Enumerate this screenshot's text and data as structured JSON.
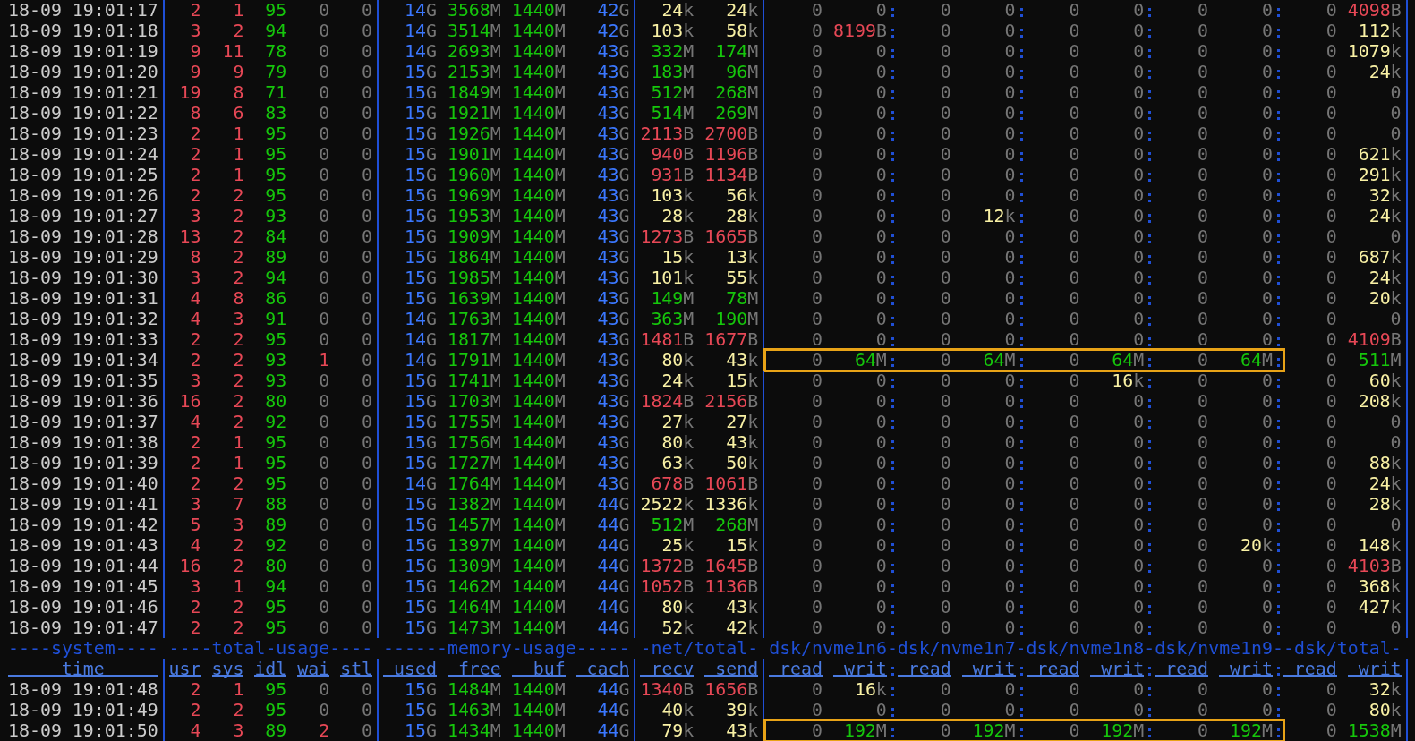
{
  "rows": [
    {
      "time": "18-09 19:01:17",
      "values": [
        "2",
        "1",
        "95",
        "0",
        "0",
        "14G",
        "3568M",
        "1440M",
        "42G",
        "24k",
        "24k",
        "0",
        "0",
        "0",
        "0",
        "0",
        "0",
        "0",
        "0",
        "0",
        "4098B"
      ],
      "highlighted": false
    },
    {
      "time": "18-09 19:01:18",
      "values": [
        "3",
        "2",
        "94",
        "0",
        "0",
        "14G",
        "3514M",
        "1440M",
        "42G",
        "103k",
        "58k",
        "0",
        "8199B",
        "0",
        "0",
        "0",
        "0",
        "0",
        "0",
        "0",
        "112k"
      ],
      "highlighted": false
    },
    {
      "time": "18-09 19:01:19",
      "values": [
        "9",
        "11",
        "78",
        "0",
        "0",
        "14G",
        "2693M",
        "1440M",
        "43G",
        "332M",
        "174M",
        "0",
        "0",
        "0",
        "0",
        "0",
        "0",
        "0",
        "0",
        "0",
        "1079k"
      ],
      "highlighted": false
    },
    {
      "time": "18-09 19:01:20",
      "values": [
        "9",
        "9",
        "79",
        "0",
        "0",
        "15G",
        "2153M",
        "1440M",
        "43G",
        "183M",
        "96M",
        "0",
        "0",
        "0",
        "0",
        "0",
        "0",
        "0",
        "0",
        "0",
        "24k"
      ],
      "highlighted": false
    },
    {
      "time": "18-09 19:01:21",
      "values": [
        "19",
        "8",
        "71",
        "0",
        "0",
        "15G",
        "1849M",
        "1440M",
        "43G",
        "512M",
        "268M",
        "0",
        "0",
        "0",
        "0",
        "0",
        "0",
        "0",
        "0",
        "0",
        "0"
      ],
      "highlighted": false
    },
    {
      "time": "18-09 19:01:22",
      "values": [
        "8",
        "6",
        "83",
        "0",
        "0",
        "15G",
        "1921M",
        "1440M",
        "43G",
        "514M",
        "269M",
        "0",
        "0",
        "0",
        "0",
        "0",
        "0",
        "0",
        "0",
        "0",
        "0"
      ],
      "highlighted": false
    },
    {
      "time": "18-09 19:01:23",
      "values": [
        "2",
        "1",
        "95",
        "0",
        "0",
        "15G",
        "1926M",
        "1440M",
        "43G",
        "2113B",
        "2700B",
        "0",
        "0",
        "0",
        "0",
        "0",
        "0",
        "0",
        "0",
        "0",
        "0"
      ],
      "highlighted": false
    },
    {
      "time": "18-09 19:01:24",
      "values": [
        "2",
        "1",
        "95",
        "0",
        "0",
        "15G",
        "1901M",
        "1440M",
        "43G",
        "940B",
        "1196B",
        "0",
        "0",
        "0",
        "0",
        "0",
        "0",
        "0",
        "0",
        "0",
        "621k"
      ],
      "highlighted": false
    },
    {
      "time": "18-09 19:01:25",
      "values": [
        "2",
        "1",
        "95",
        "0",
        "0",
        "15G",
        "1960M",
        "1440M",
        "43G",
        "931B",
        "1134B",
        "0",
        "0",
        "0",
        "0",
        "0",
        "0",
        "0",
        "0",
        "0",
        "291k"
      ],
      "highlighted": false
    },
    {
      "time": "18-09 19:01:26",
      "values": [
        "2",
        "2",
        "95",
        "0",
        "0",
        "15G",
        "1969M",
        "1440M",
        "43G",
        "103k",
        "56k",
        "0",
        "0",
        "0",
        "0",
        "0",
        "0",
        "0",
        "0",
        "0",
        "32k"
      ],
      "highlighted": false
    },
    {
      "time": "18-09 19:01:27",
      "values": [
        "3",
        "2",
        "93",
        "0",
        "0",
        "15G",
        "1953M",
        "1440M",
        "43G",
        "28k",
        "28k",
        "0",
        "0",
        "0",
        "12k",
        "0",
        "0",
        "0",
        "0",
        "0",
        "24k"
      ],
      "highlighted": false
    },
    {
      "time": "18-09 19:01:28",
      "values": [
        "13",
        "2",
        "84",
        "0",
        "0",
        "15G",
        "1909M",
        "1440M",
        "43G",
        "1273B",
        "1665B",
        "0",
        "0",
        "0",
        "0",
        "0",
        "0",
        "0",
        "0",
        "0",
        "0"
      ],
      "highlighted": false
    },
    {
      "time": "18-09 19:01:29",
      "values": [
        "8",
        "2",
        "89",
        "0",
        "0",
        "15G",
        "1864M",
        "1440M",
        "43G",
        "15k",
        "13k",
        "0",
        "0",
        "0",
        "0",
        "0",
        "0",
        "0",
        "0",
        "0",
        "687k"
      ],
      "highlighted": false
    },
    {
      "time": "18-09 19:01:30",
      "values": [
        "3",
        "2",
        "94",
        "0",
        "0",
        "15G",
        "1985M",
        "1440M",
        "43G",
        "101k",
        "55k",
        "0",
        "0",
        "0",
        "0",
        "0",
        "0",
        "0",
        "0",
        "0",
        "24k"
      ],
      "highlighted": false
    },
    {
      "time": "18-09 19:01:31",
      "values": [
        "4",
        "8",
        "86",
        "0",
        "0",
        "15G",
        "1639M",
        "1440M",
        "43G",
        "149M",
        "78M",
        "0",
        "0",
        "0",
        "0",
        "0",
        "0",
        "0",
        "0",
        "0",
        "20k"
      ],
      "highlighted": false
    },
    {
      "time": "18-09 19:01:32",
      "values": [
        "4",
        "3",
        "91",
        "0",
        "0",
        "14G",
        "1763M",
        "1440M",
        "43G",
        "363M",
        "190M",
        "0",
        "0",
        "0",
        "0",
        "0",
        "0",
        "0",
        "0",
        "0",
        "0"
      ],
      "highlighted": false
    },
    {
      "time": "18-09 19:01:33",
      "values": [
        "2",
        "2",
        "95",
        "0",
        "0",
        "14G",
        "1817M",
        "1440M",
        "43G",
        "1481B",
        "1677B",
        "0",
        "0",
        "0",
        "0",
        "0",
        "0",
        "0",
        "0",
        "0",
        "4109B"
      ],
      "highlighted": false
    },
    {
      "time": "18-09 19:01:34",
      "values": [
        "2",
        "2",
        "93",
        "1",
        "0",
        "14G",
        "1791M",
        "1440M",
        "43G",
        "80k",
        "43k",
        "0",
        "64M",
        "0",
        "64M",
        "0",
        "64M",
        "0",
        "64M",
        "0",
        "511M"
      ],
      "highlighted": true
    },
    {
      "time": "18-09 19:01:35",
      "values": [
        "3",
        "2",
        "93",
        "0",
        "0",
        "15G",
        "1741M",
        "1440M",
        "43G",
        "24k",
        "15k",
        "0",
        "0",
        "0",
        "0",
        "0",
        "16k",
        "0",
        "0",
        "0",
        "60k"
      ],
      "highlighted": false
    },
    {
      "time": "18-09 19:01:36",
      "values": [
        "16",
        "2",
        "80",
        "0",
        "0",
        "15G",
        "1703M",
        "1440M",
        "43G",
        "1824B",
        "2156B",
        "0",
        "0",
        "0",
        "0",
        "0",
        "0",
        "0",
        "0",
        "0",
        "208k"
      ],
      "highlighted": false
    },
    {
      "time": "18-09 19:01:37",
      "values": [
        "4",
        "2",
        "92",
        "0",
        "0",
        "15G",
        "1755M",
        "1440M",
        "43G",
        "27k",
        "27k",
        "0",
        "0",
        "0",
        "0",
        "0",
        "0",
        "0",
        "0",
        "0",
        "0"
      ],
      "highlighted": false
    },
    {
      "time": "18-09 19:01:38",
      "values": [
        "2",
        "1",
        "95",
        "0",
        "0",
        "15G",
        "1756M",
        "1440M",
        "43G",
        "80k",
        "43k",
        "0",
        "0",
        "0",
        "0",
        "0",
        "0",
        "0",
        "0",
        "0",
        "0"
      ],
      "highlighted": false
    },
    {
      "time": "18-09 19:01:39",
      "values": [
        "2",
        "1",
        "95",
        "0",
        "0",
        "15G",
        "1727M",
        "1440M",
        "43G",
        "63k",
        "50k",
        "0",
        "0",
        "0",
        "0",
        "0",
        "0",
        "0",
        "0",
        "0",
        "88k"
      ],
      "highlighted": false
    },
    {
      "time": "18-09 19:01:40",
      "values": [
        "2",
        "2",
        "95",
        "0",
        "0",
        "14G",
        "1764M",
        "1440M",
        "43G",
        "678B",
        "1061B",
        "0",
        "0",
        "0",
        "0",
        "0",
        "0",
        "0",
        "0",
        "0",
        "24k"
      ],
      "highlighted": false
    },
    {
      "time": "18-09 19:01:41",
      "values": [
        "3",
        "7",
        "88",
        "0",
        "0",
        "15G",
        "1382M",
        "1440M",
        "44G",
        "2522k",
        "1336k",
        "0",
        "0",
        "0",
        "0",
        "0",
        "0",
        "0",
        "0",
        "0",
        "28k"
      ],
      "highlighted": false
    },
    {
      "time": "18-09 19:01:42",
      "values": [
        "5",
        "3",
        "89",
        "0",
        "0",
        "15G",
        "1457M",
        "1440M",
        "44G",
        "512M",
        "268M",
        "0",
        "0",
        "0",
        "0",
        "0",
        "0",
        "0",
        "0",
        "0",
        "0"
      ],
      "highlighted": false
    },
    {
      "time": "18-09 19:01:43",
      "values": [
        "4",
        "2",
        "92",
        "0",
        "0",
        "15G",
        "1397M",
        "1440M",
        "44G",
        "25k",
        "15k",
        "0",
        "0",
        "0",
        "0",
        "0",
        "0",
        "0",
        "20k",
        "0",
        "148k"
      ],
      "highlighted": false
    },
    {
      "time": "18-09 19:01:44",
      "values": [
        "16",
        "2",
        "80",
        "0",
        "0",
        "15G",
        "1309M",
        "1440M",
        "44G",
        "1372B",
        "1645B",
        "0",
        "0",
        "0",
        "0",
        "0",
        "0",
        "0",
        "0",
        "0",
        "4103B"
      ],
      "highlighted": false
    },
    {
      "time": "18-09 19:01:45",
      "values": [
        "3",
        "1",
        "94",
        "0",
        "0",
        "15G",
        "1462M",
        "1440M",
        "44G",
        "1052B",
        "1136B",
        "0",
        "0",
        "0",
        "0",
        "0",
        "0",
        "0",
        "0",
        "0",
        "368k"
      ],
      "highlighted": false
    },
    {
      "time": "18-09 19:01:46",
      "values": [
        "2",
        "2",
        "95",
        "0",
        "0",
        "15G",
        "1464M",
        "1440M",
        "44G",
        "80k",
        "43k",
        "0",
        "0",
        "0",
        "0",
        "0",
        "0",
        "0",
        "0",
        "0",
        "427k"
      ],
      "highlighted": false
    },
    {
      "time": "18-09 19:01:47",
      "values": [
        "2",
        "2",
        "95",
        "0",
        "0",
        "15G",
        "1473M",
        "1440M",
        "44G",
        "52k",
        "42k",
        "0",
        "0",
        "0",
        "0",
        "0",
        "0",
        "0",
        "0",
        "0",
        "0"
      ],
      "highlighted": false
    }
  ],
  "header": {
    "groups": [
      "----system----",
      "----total-usage----",
      "------memory-usage-----",
      "-net/total-",
      "dsk/nvme1n6-dsk/nvme1n7-dsk/nvme1n8-dsk/nvme1n9--dsk/total-"
    ],
    "columns": [
      "time",
      "usr",
      "sys",
      "idl",
      "wai",
      "stl",
      "used",
      "free",
      "buf",
      "cach",
      "recv",
      "send",
      "read",
      "writ",
      "read",
      "writ",
      "read",
      "writ",
      "read",
      "writ",
      "read",
      "writ"
    ]
  },
  "more_rows": [
    {
      "time": "18-09 19:01:48",
      "values": [
        "2",
        "1",
        "95",
        "0",
        "0",
        "15G",
        "1484M",
        "1440M",
        "44G",
        "1340B",
        "1656B",
        "0",
        "16k",
        "0",
        "0",
        "0",
        "0",
        "0",
        "0",
        "0",
        "32k"
      ],
      "highlighted": false
    },
    {
      "time": "18-09 19:01:49",
      "values": [
        "2",
        "2",
        "95",
        "0",
        "0",
        "15G",
        "1463M",
        "1440M",
        "44G",
        "40k",
        "39k",
        "0",
        "0",
        "0",
        "0",
        "0",
        "0",
        "0",
        "0",
        "0",
        "80k"
      ],
      "highlighted": false
    },
    {
      "time": "18-09 19:01:50",
      "values": [
        "4",
        "3",
        "89",
        "2",
        "0",
        "15G",
        "1434M",
        "1440M",
        "44G",
        "79k",
        "43k",
        "0",
        "192M",
        "0",
        "192M",
        "0",
        "192M",
        "0",
        "192M",
        "0",
        "1538M"
      ],
      "highlighted": true
    }
  ]
}
